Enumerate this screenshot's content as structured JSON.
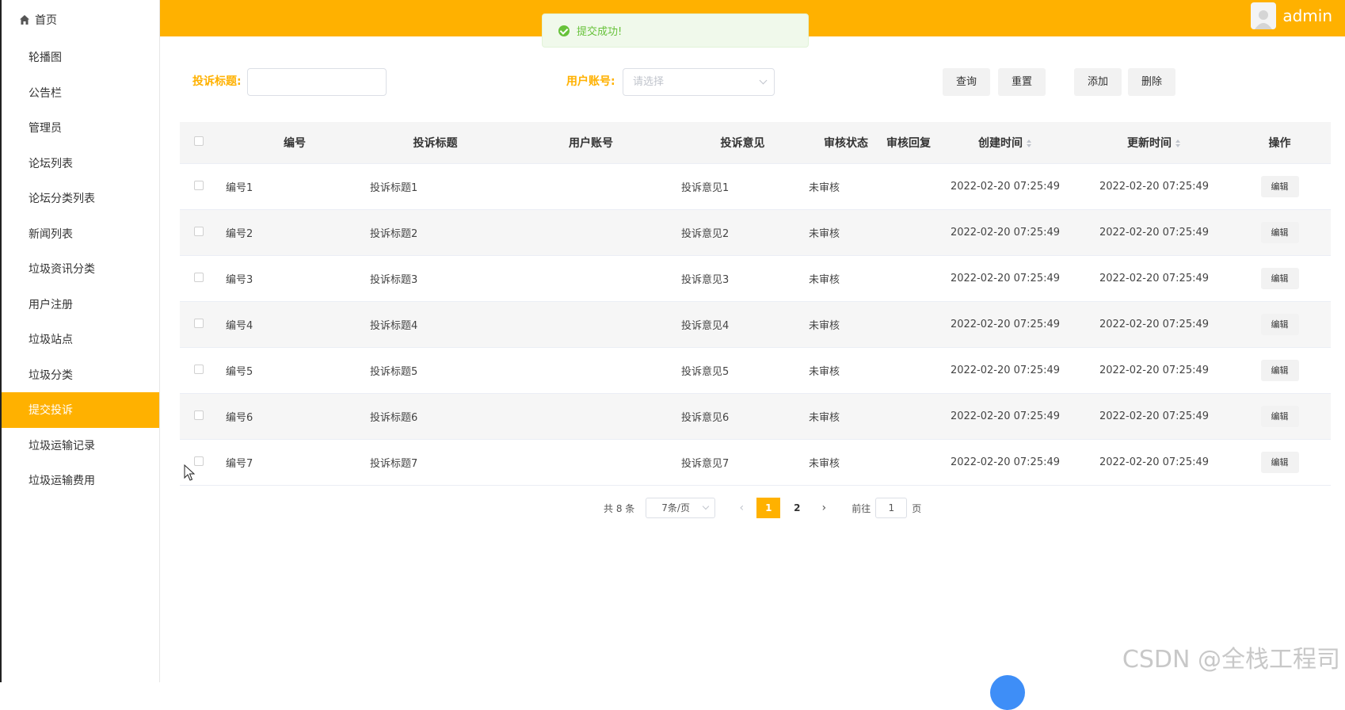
{
  "sidebar": {
    "home_label": "首页",
    "items": [
      {
        "label": "轮播图"
      },
      {
        "label": "公告栏"
      },
      {
        "label": "管理员"
      },
      {
        "label": "论坛列表"
      },
      {
        "label": "论坛分类列表"
      },
      {
        "label": "新闻列表"
      },
      {
        "label": "垃圾资讯分类"
      },
      {
        "label": "用户注册"
      },
      {
        "label": "垃圾站点"
      },
      {
        "label": "垃圾分类"
      },
      {
        "label": "提交投诉"
      },
      {
        "label": "垃圾运输记录"
      },
      {
        "label": "垃圾运输费用"
      }
    ],
    "active_index": 10
  },
  "header": {
    "username": "admin",
    "accent_color": "#ffb100"
  },
  "toast": {
    "message": "提交成功!"
  },
  "search": {
    "title_label": "投诉标题:",
    "title_value": "",
    "account_label": "用户账号:",
    "account_placeholder": "请选择",
    "query_button": "查询",
    "reset_button": "重置",
    "add_button": "添加",
    "delete_button": "删除"
  },
  "table": {
    "columns": [
      "编号",
      "投诉标题",
      "用户账号",
      "投诉意见",
      "审核状态",
      "审核回复",
      "创建时间",
      "更新时间",
      "操作"
    ],
    "edit_label": "编辑",
    "rows": [
      {
        "id": "编号1",
        "title": "投诉标题1",
        "account": "",
        "opinion": "投诉意见1",
        "status": "未审核",
        "reply": "",
        "created": "2022-02-20 07:25:49",
        "updated": "2022-02-20 07:25:49"
      },
      {
        "id": "编号2",
        "title": "投诉标题2",
        "account": "",
        "opinion": "投诉意见2",
        "status": "未审核",
        "reply": "",
        "created": "2022-02-20 07:25:49",
        "updated": "2022-02-20 07:25:49"
      },
      {
        "id": "编号3",
        "title": "投诉标题3",
        "account": "",
        "opinion": "投诉意见3",
        "status": "未审核",
        "reply": "",
        "created": "2022-02-20 07:25:49",
        "updated": "2022-02-20 07:25:49"
      },
      {
        "id": "编号4",
        "title": "投诉标题4",
        "account": "",
        "opinion": "投诉意见4",
        "status": "未审核",
        "reply": "",
        "created": "2022-02-20 07:25:49",
        "updated": "2022-02-20 07:25:49"
      },
      {
        "id": "编号5",
        "title": "投诉标题5",
        "account": "",
        "opinion": "投诉意见5",
        "status": "未审核",
        "reply": "",
        "created": "2022-02-20 07:25:49",
        "updated": "2022-02-20 07:25:49"
      },
      {
        "id": "编号6",
        "title": "投诉标题6",
        "account": "",
        "opinion": "投诉意见6",
        "status": "未审核",
        "reply": "",
        "created": "2022-02-20 07:25:49",
        "updated": "2022-02-20 07:25:49"
      },
      {
        "id": "编号7",
        "title": "投诉标题7",
        "account": "",
        "opinion": "投诉意见7",
        "status": "未审核",
        "reply": "",
        "created": "2022-02-20 07:25:49",
        "updated": "2022-02-20 07:25:49"
      }
    ]
  },
  "pagination": {
    "total_text": "共 8 条",
    "page_size": "7条/页",
    "pages": [
      "1",
      "2"
    ],
    "current_page": "1",
    "goto_label": "前往",
    "goto_value": "1",
    "page_suffix": "页"
  },
  "watermark": "CSDN @全栈工程司"
}
